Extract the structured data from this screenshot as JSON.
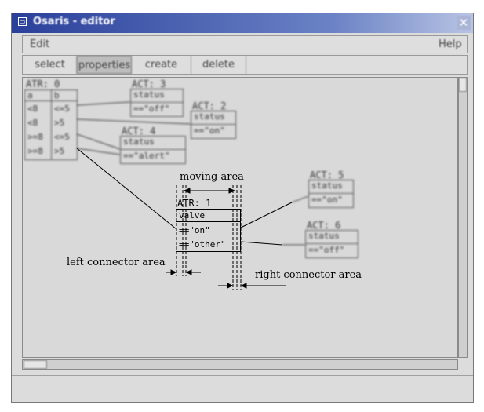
{
  "window": {
    "title": "Osaris - editor",
    "close_glyph": "✕"
  },
  "menu": {
    "edit": "Edit",
    "help": "Help"
  },
  "tabs": [
    "select",
    "properties",
    "create",
    "delete"
  ],
  "diagram": {
    "atr_table": {
      "label": "ATR: 0",
      "headers": [
        "a",
        "b"
      ],
      "rows": [
        [
          "<8",
          "<=5"
        ],
        [
          "<8",
          ">5"
        ],
        [
          ">=8",
          "<=5"
        ],
        [
          ">=8",
          ">5"
        ]
      ]
    },
    "act_nodes": [
      {
        "label": "ACT: 3",
        "field": "status",
        "value": "==\"off\""
      },
      {
        "label": "ACT: 2",
        "field": "status",
        "value": "==\"on\""
      },
      {
        "label": "ACT: 4",
        "field": "status",
        "value": "==\"alert\""
      },
      {
        "label": "ACT: 5",
        "field": "status",
        "value": "==\"on\""
      },
      {
        "label": "ACT: 6",
        "field": "status",
        "value": "==\"off\""
      }
    ],
    "atr_focus": {
      "label": "ATR: 1",
      "field": "valve",
      "rows": [
        "==\"on\"",
        "==\"other\""
      ]
    },
    "annotations": {
      "moving_area": "moving area",
      "left_connector": "left connector area",
      "right_connector": "right connector area"
    }
  }
}
